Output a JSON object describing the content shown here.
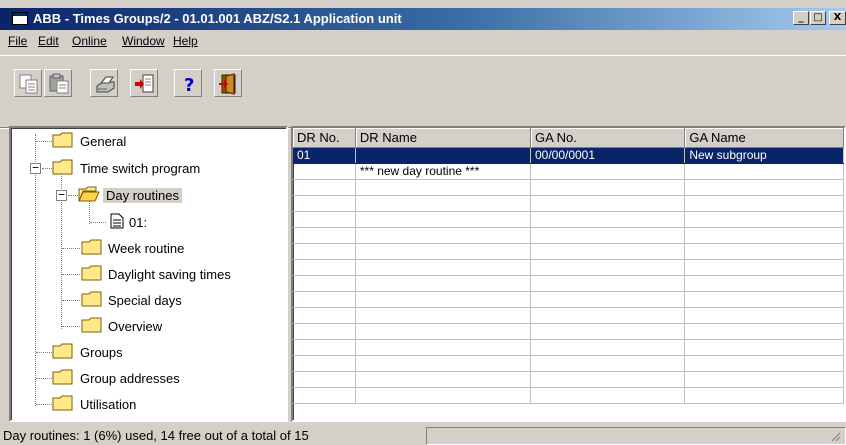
{
  "window": {
    "title": "ABB - Times Groups/2 - 01.01.001 ABZ/S2.1 Application unit",
    "controls": {
      "minimize": "_",
      "maximize": "□",
      "close": "X"
    }
  },
  "menu": [
    {
      "label": "File"
    },
    {
      "label": "Edit"
    },
    {
      "label": "Online"
    },
    {
      "label": "Window"
    },
    {
      "label": "Help"
    }
  ],
  "toolbar": {
    "buttons": [
      {
        "icon": "copy-icon"
      },
      {
        "icon": "paste-icon"
      },
      {
        "icon": "print-icon"
      },
      {
        "icon": "import-icon"
      },
      {
        "icon": "help-icon",
        "glyph": "?"
      },
      {
        "icon": "exit-icon"
      }
    ]
  },
  "tree": {
    "nodes": [
      {
        "label": "General"
      },
      {
        "label": "Time switch program",
        "expanded": true
      },
      {
        "label": "Day routines",
        "expanded": true,
        "selected": true
      },
      {
        "label": "01:"
      },
      {
        "label": "Week routine"
      },
      {
        "label": "Daylight saving times"
      },
      {
        "label": "Special days"
      },
      {
        "label": "Overview"
      },
      {
        "label": "Groups"
      },
      {
        "label": "Group addresses"
      },
      {
        "label": "Utilisation"
      }
    ],
    "expander_minus": "−"
  },
  "grid": {
    "columns": [
      "DR No.",
      "DR Name",
      "GA No.",
      "GA Name"
    ],
    "rows": [
      [
        "01",
        "",
        "00/00/0001",
        "New subgroup"
      ],
      [
        "",
        "*** new day routine ***",
        "",
        ""
      ]
    ],
    "empty_rows": 12
  },
  "status": {
    "text": "Day routines: 1 (6%) used, 14 free out of a total of 15"
  },
  "colors": {
    "selection": "#0a246a",
    "face": "#d4d0c8"
  }
}
